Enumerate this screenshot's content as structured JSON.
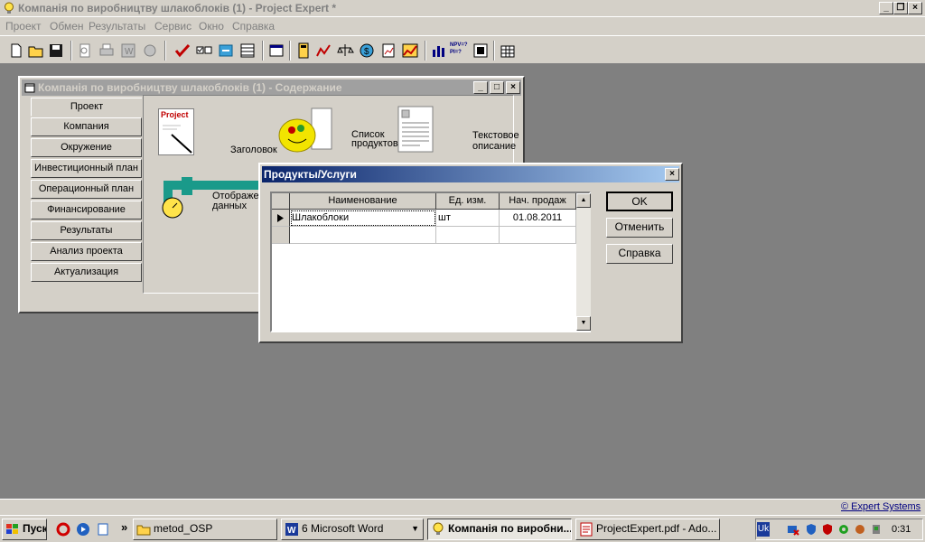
{
  "app": {
    "title": "Компанія по виробництву шлакоблоків (1) - Project Expert *"
  },
  "menu": [
    "Проект",
    "Обмен",
    "Результаты",
    "Сервис",
    "Окно",
    "Справка"
  ],
  "toolbar": {
    "npv_label": "NPV=?\nPI=?"
  },
  "content_window": {
    "title": "Компанія по виробництву шлакоблоків (1) - Содержание",
    "nav": [
      "Проект",
      "Компания",
      "Окружение",
      "Инвестиционный план",
      "Операционный план",
      "Финансирование",
      "Результаты",
      "Анализ проекта",
      "Актуализация"
    ],
    "tiles": {
      "title_label": "Заголовок",
      "title_logo": "Project",
      "products_label": "Список\nпродуктов",
      "text_label": "Текстовое\nописание",
      "display_label": "Отображение\nданных"
    }
  },
  "dialog": {
    "title": "Продукты/Услуги",
    "columns": [
      "Наименование",
      "Ед. изм.",
      "Нач. продаж"
    ],
    "rows": [
      {
        "name": "Шлакоблоки",
        "unit": "шт",
        "start": "01.08.2011"
      }
    ],
    "buttons": {
      "ok": "OK",
      "cancel": "Отменить",
      "help": "Справка"
    }
  },
  "statusbar": {
    "link": "© Expert Systems"
  },
  "taskbar": {
    "start": "Пуск",
    "more": "»",
    "tasks": [
      "metod_OSP",
      "6 Microsoft Word",
      "Компанія по виробни...",
      "ProjectExpert.pdf - Ado..."
    ],
    "lang": "Uk",
    "time": "0:31"
  }
}
